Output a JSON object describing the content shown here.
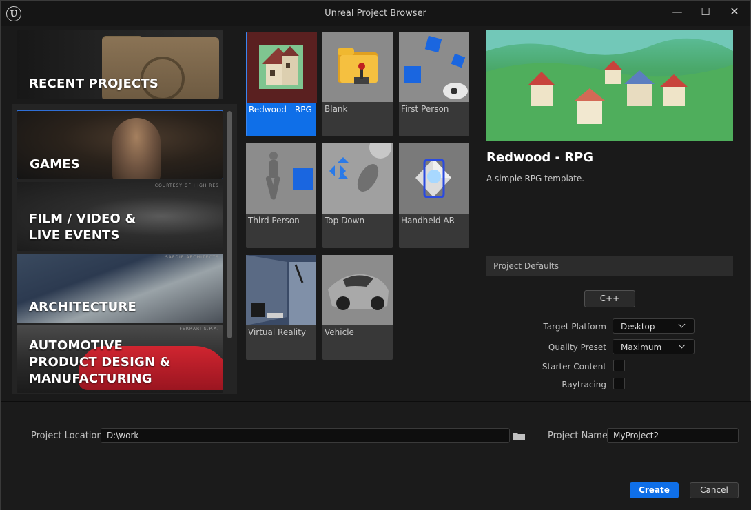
{
  "window": {
    "title": "Unreal Project Browser",
    "logo_glyph": "U",
    "controls": {
      "minimize": "—",
      "maximize": "☐",
      "close": "✕"
    }
  },
  "categories": [
    {
      "label": "RECENT PROJECTS",
      "credit": ""
    },
    {
      "label": "GAMES",
      "credit": "",
      "selected": true
    },
    {
      "label": "FILM / VIDEO & LIVE EVENTS",
      "line1": "FILM / VIDEO &",
      "line2": "LIVE EVENTS",
      "credit": "COURTESY OF HIGH RES"
    },
    {
      "label": "ARCHITECTURE",
      "credit": "SAFDIE ARCHITECTS"
    },
    {
      "label": "AUTOMOTIVE PRODUCT DESIGN & MANUFACTURING",
      "line1": "AUTOMOTIVE",
      "line2": "PRODUCT DESIGN &",
      "line3": "MANUFACTURING",
      "credit": "FERRARI S.P.A."
    }
  ],
  "templates": [
    {
      "label": "Redwood - RPG",
      "selected": true
    },
    {
      "label": "Blank"
    },
    {
      "label": "First Person"
    },
    {
      "label": "Third Person"
    },
    {
      "label": "Top Down"
    },
    {
      "label": "Handheld AR"
    },
    {
      "label": "Virtual Reality"
    },
    {
      "label": "Vehicle"
    }
  ],
  "details": {
    "title": "Redwood - RPG",
    "description": "A simple RPG template."
  },
  "project_defaults": {
    "header": "Project Defaults",
    "language_button": "C++",
    "target_platform": {
      "label": "Target Platform",
      "value": "Desktop"
    },
    "quality_preset": {
      "label": "Quality Preset",
      "value": "Maximum"
    },
    "starter_content": {
      "label": "Starter Content",
      "checked": false
    },
    "raytracing": {
      "label": "Raytracing",
      "checked": false
    }
  },
  "footer": {
    "location_label": "Project Location",
    "location_value": "D:\\work",
    "name_label": "Project Name",
    "name_value": "MyProject2",
    "create": "Create",
    "cancel": "Cancel"
  },
  "colors": {
    "accent": "#0f6fe8",
    "background": "#1a1a1a",
    "panel": "#242424"
  }
}
